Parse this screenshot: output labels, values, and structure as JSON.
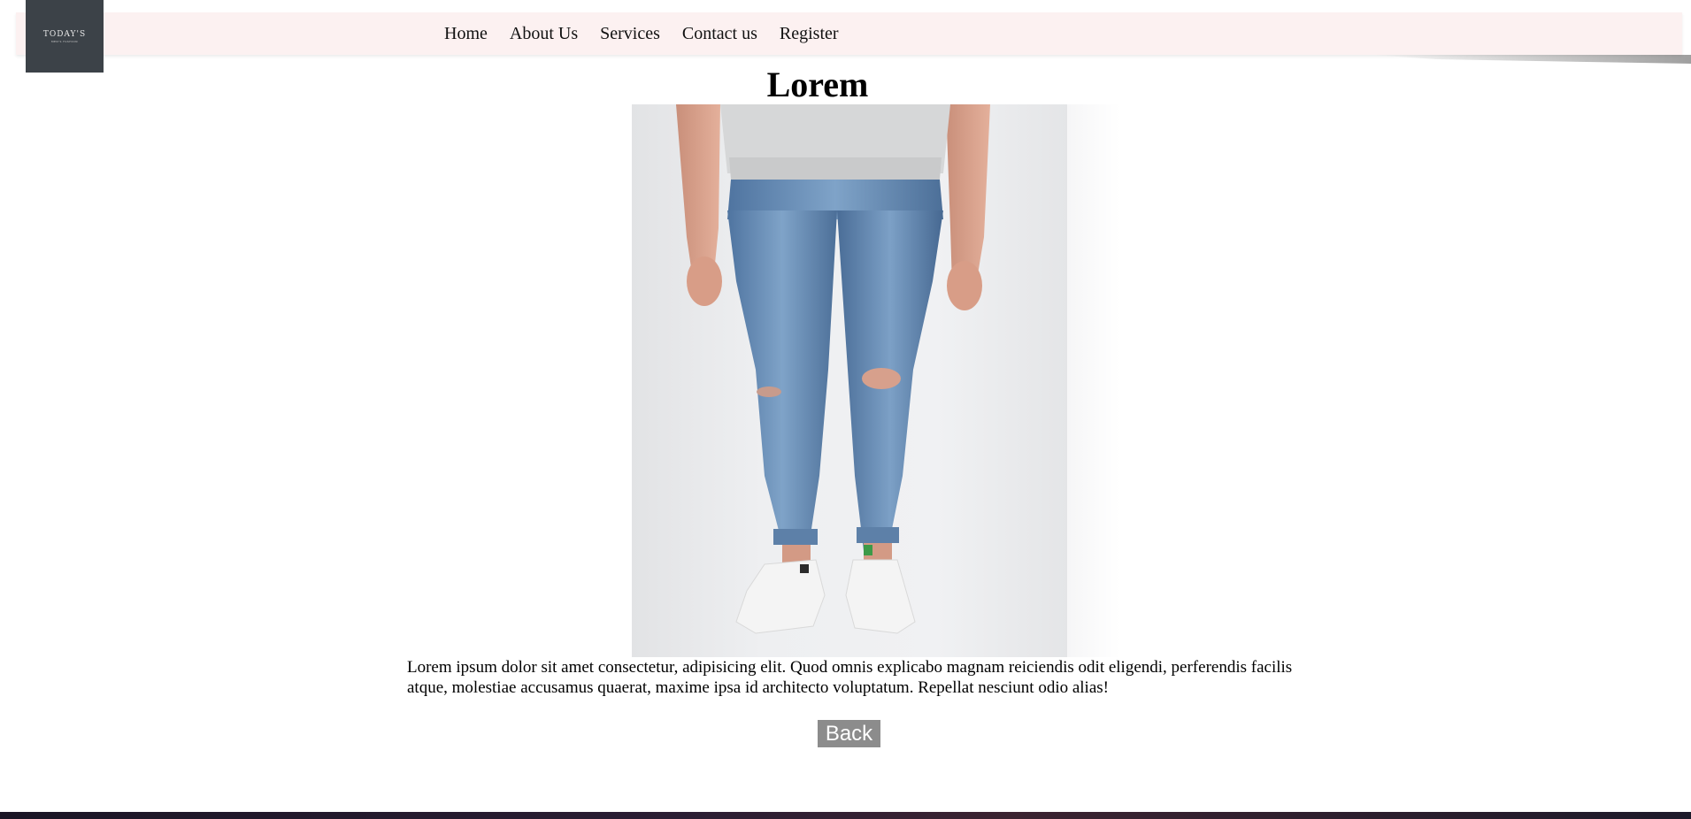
{
  "logo": {
    "text": "TODAY'S",
    "subtext": "MEN'S FASHION"
  },
  "nav": {
    "items": [
      {
        "label": "Home"
      },
      {
        "label": "About Us"
      },
      {
        "label": "Services"
      },
      {
        "label": "Contact us"
      },
      {
        "label": "Register"
      }
    ]
  },
  "product": {
    "title": "Lorem",
    "image_icon": "jeans-photo",
    "description": "Lorem ipsum dolor sit amet consectetur, adipisicing elit. Quod omnis explicabo magnam reiciendis odit eligendi, perferendis facilis atque, molestiae accusamus quaerat, maxime ipsa id architecto voluptatum. Repellat nesciunt odio alias!"
  },
  "actions": {
    "back_label": "Back"
  },
  "colors": {
    "navbar_bg": "#fcf1f1",
    "logo_bg": "#3c4248",
    "button_bg": "#8c8c8c",
    "footer_bg": "#1a1525"
  }
}
